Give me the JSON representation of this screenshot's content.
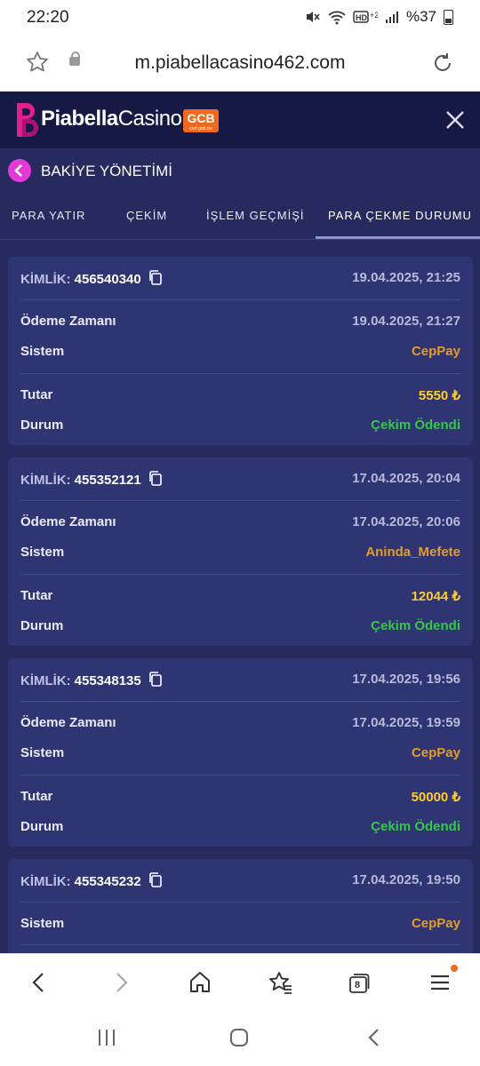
{
  "status_bar": {
    "time": "22:20",
    "battery": "%37",
    "icons": [
      "mute-icon",
      "wifi-icon",
      "hd-icon",
      "signal-icon",
      "battery-icon"
    ]
  },
  "browser": {
    "url": "m.piabellacasino462.com",
    "tab_count": "8"
  },
  "site": {
    "logo_text_bold": "Piabella",
    "logo_text_light": "Casino",
    "badge": "GCB",
    "badge_sub": "cert gcb cw"
  },
  "page": {
    "title": "BAKİYE YÖNETİMİ"
  },
  "tabs": [
    {
      "label": "PARA YATIR"
    },
    {
      "label": "ÇEKİM"
    },
    {
      "label": "İŞLEM GEÇMİŞİ"
    },
    {
      "label": "PARA ÇEKME DURUMU",
      "active": true
    }
  ],
  "labels": {
    "id": "KİMLİK:",
    "payment_time": "Ödeme Zamanı",
    "system": "Sistem",
    "amount": "Tutar",
    "status": "Durum"
  },
  "withdrawals": [
    {
      "id": "456540340",
      "date": "19.04.2025, 21:25",
      "payment_time": "19.04.2025, 21:27",
      "system": "CepPay",
      "amount": "5550 ₺",
      "status": "Çekim Ödendi"
    },
    {
      "id": "455352121",
      "date": "17.04.2025, 20:04",
      "payment_time": "17.04.2025, 20:06",
      "system": "Aninda_Mefete",
      "amount": "12044 ₺",
      "status": "Çekim Ödendi"
    },
    {
      "id": "455348135",
      "date": "17.04.2025, 19:56",
      "payment_time": "17.04.2025, 19:59",
      "system": "CepPay",
      "amount": "50000 ₺",
      "status": "Çekim Ödendi"
    },
    {
      "id": "455345232",
      "date": "17.04.2025, 19:50",
      "system": "CepPay"
    }
  ],
  "colors": {
    "background": "#262a5e",
    "card": "#2f3472",
    "header": "#161944",
    "system": "#e39c2a",
    "amount": "#ffcd2b",
    "status_paid": "#35c74a",
    "logo_pink": "#e1208f",
    "badge_orange": "#f06a1e"
  }
}
